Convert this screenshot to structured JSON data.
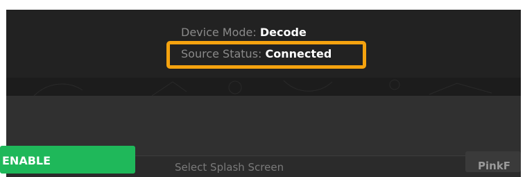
{
  "status": {
    "device_mode_label": "Device Mode:",
    "device_mode_value": "Decode",
    "source_status_label": "Source Status:",
    "source_status_value": "Connected"
  },
  "actions": {
    "enable_label": "ENABLE"
  },
  "splash": {
    "label": "Select Splash Screen",
    "value": "PinkF"
  },
  "colors": {
    "highlight": "#f5a30f",
    "enable": "#1fb85a",
    "header_bg": "#222222",
    "panel_bg": "#2b2b2b"
  }
}
